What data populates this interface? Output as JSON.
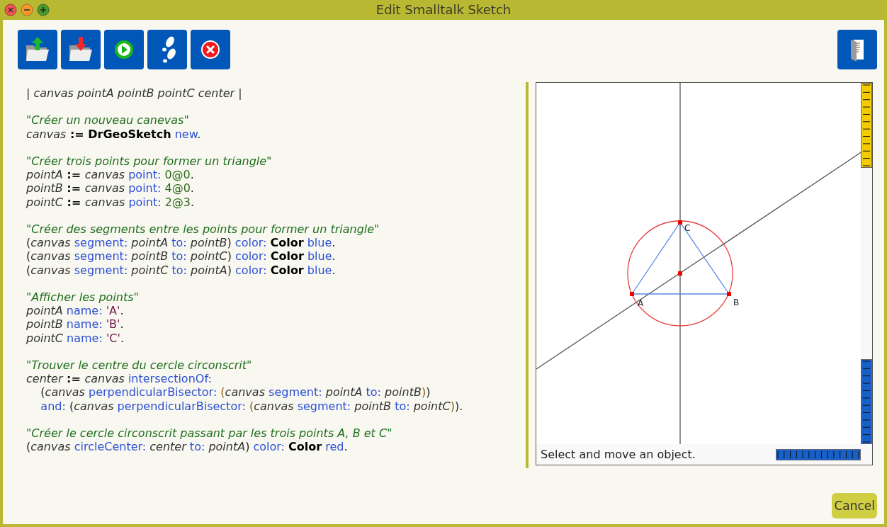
{
  "window": {
    "title": "Edit Smalltalk Sketch"
  },
  "code": [
    [
      [
        {
          "kind": "var",
          "text": "| canvas pointA pointB pointC center |"
        }
      ]
    ],
    [
      [
        {
          "kind": "comment",
          "text": "\"Créer un nouveau canevas\""
        }
      ],
      [
        {
          "kind": "var",
          "text": "canvas"
        },
        {
          "kind": "op",
          "text": " := "
        },
        {
          "kind": "cls",
          "text": "DrGeoSketch"
        },
        {
          "kind": "msg",
          "text": " new"
        },
        {
          "kind": "plain",
          "text": "."
        }
      ]
    ],
    [
      [
        {
          "kind": "comment",
          "text": "\"Créer trois points pour former un triangle\""
        }
      ],
      [
        {
          "kind": "var",
          "text": "pointA"
        },
        {
          "kind": "op",
          "text": " := "
        },
        {
          "kind": "var",
          "text": "canvas"
        },
        {
          "kind": "msg",
          "text": " point: "
        },
        {
          "kind": "num",
          "text": "0@0"
        },
        {
          "kind": "plain",
          "text": "."
        }
      ],
      [
        {
          "kind": "var",
          "text": "pointB"
        },
        {
          "kind": "op",
          "text": " := "
        },
        {
          "kind": "var",
          "text": "canvas"
        },
        {
          "kind": "msg",
          "text": " point: "
        },
        {
          "kind": "num",
          "text": "4@0"
        },
        {
          "kind": "plain",
          "text": "."
        }
      ],
      [
        {
          "kind": "var",
          "text": "pointC"
        },
        {
          "kind": "op",
          "text": " := "
        },
        {
          "kind": "var",
          "text": "canvas"
        },
        {
          "kind": "msg",
          "text": " point: "
        },
        {
          "kind": "num",
          "text": "2@3"
        },
        {
          "kind": "plain",
          "text": "."
        }
      ]
    ],
    [
      [
        {
          "kind": "comment",
          "text": "\"Créer des segments entre les points pour former un triangle\""
        }
      ],
      [
        {
          "kind": "plain",
          "text": "("
        },
        {
          "kind": "var",
          "text": "canvas"
        },
        {
          "kind": "msg",
          "text": " segment: "
        },
        {
          "kind": "var",
          "text": "pointA"
        },
        {
          "kind": "msg",
          "text": " to: "
        },
        {
          "kind": "var",
          "text": "pointB"
        },
        {
          "kind": "plain",
          "text": ")"
        },
        {
          "kind": "msg",
          "text": " color: "
        },
        {
          "kind": "cls",
          "text": "Color"
        },
        {
          "kind": "msg",
          "text": " blue"
        },
        {
          "kind": "plain",
          "text": "."
        }
      ],
      [
        {
          "kind": "plain",
          "text": "("
        },
        {
          "kind": "var",
          "text": "canvas"
        },
        {
          "kind": "msg",
          "text": " segment: "
        },
        {
          "kind": "var",
          "text": "pointB"
        },
        {
          "kind": "msg",
          "text": " to: "
        },
        {
          "kind": "var",
          "text": "pointC"
        },
        {
          "kind": "plain",
          "text": ")"
        },
        {
          "kind": "msg",
          "text": " color: "
        },
        {
          "kind": "cls",
          "text": "Color"
        },
        {
          "kind": "msg",
          "text": " blue"
        },
        {
          "kind": "plain",
          "text": "."
        }
      ],
      [
        {
          "kind": "plain",
          "text": "("
        },
        {
          "kind": "var",
          "text": "canvas"
        },
        {
          "kind": "msg",
          "text": " segment: "
        },
        {
          "kind": "var",
          "text": "pointC"
        },
        {
          "kind": "msg",
          "text": " to: "
        },
        {
          "kind": "var",
          "text": "pointA"
        },
        {
          "kind": "plain",
          "text": ")"
        },
        {
          "kind": "msg",
          "text": " color: "
        },
        {
          "kind": "cls",
          "text": "Color"
        },
        {
          "kind": "msg",
          "text": " blue"
        },
        {
          "kind": "plain",
          "text": "."
        }
      ]
    ],
    [
      [
        {
          "kind": "comment",
          "text": "\"Afficher les points\""
        }
      ],
      [
        {
          "kind": "var",
          "text": "pointA"
        },
        {
          "kind": "msg",
          "text": " name: "
        },
        {
          "kind": "str",
          "text": "'A'"
        },
        {
          "kind": "plain",
          "text": "."
        }
      ],
      [
        {
          "kind": "var",
          "text": "pointB"
        },
        {
          "kind": "msg",
          "text": " name: "
        },
        {
          "kind": "str",
          "text": "'B'"
        },
        {
          "kind": "plain",
          "text": "."
        }
      ],
      [
        {
          "kind": "var",
          "text": "pointC"
        },
        {
          "kind": "msg",
          "text": " name: "
        },
        {
          "kind": "str",
          "text": "'C'"
        },
        {
          "kind": "plain",
          "text": "."
        }
      ]
    ],
    [
      [
        {
          "kind": "comment",
          "text": "\"Trouver le centre du cercle circonscrit\""
        }
      ],
      [
        {
          "kind": "var",
          "text": "center"
        },
        {
          "kind": "op",
          "text": " := "
        },
        {
          "kind": "var",
          "text": "canvas"
        },
        {
          "kind": "msg",
          "text": " intersectionOf:"
        }
      ],
      [
        {
          "kind": "plain",
          "text": "    ("
        },
        {
          "kind": "var",
          "text": "canvas"
        },
        {
          "kind": "msg",
          "text": " perpendicularBisector: "
        },
        {
          "kind": "paren",
          "text": "("
        },
        {
          "kind": "var",
          "text": "canvas"
        },
        {
          "kind": "msg",
          "text": " segment: "
        },
        {
          "kind": "var",
          "text": "pointA"
        },
        {
          "kind": "msg",
          "text": " to: "
        },
        {
          "kind": "var",
          "text": "pointB"
        },
        {
          "kind": "paren",
          "text": ")"
        },
        {
          "kind": "plain",
          "text": ")"
        }
      ],
      [
        {
          "kind": "msg",
          "text": "    and: "
        },
        {
          "kind": "plain",
          "text": "("
        },
        {
          "kind": "var",
          "text": "canvas"
        },
        {
          "kind": "msg",
          "text": " perpendicularBisector: "
        },
        {
          "kind": "paren",
          "text": "("
        },
        {
          "kind": "var",
          "text": "canvas"
        },
        {
          "kind": "msg",
          "text": " segment: "
        },
        {
          "kind": "var",
          "text": "pointB"
        },
        {
          "kind": "msg",
          "text": " to: "
        },
        {
          "kind": "var",
          "text": "pointC"
        },
        {
          "kind": "paren",
          "text": ")"
        },
        {
          "kind": "plain",
          "text": ")."
        }
      ]
    ],
    [
      [
        {
          "kind": "comment",
          "text": "\"Créer le cercle circonscrit passant par les trois points A, B et C\""
        }
      ],
      [
        {
          "kind": "plain",
          "text": "("
        },
        {
          "kind": "var",
          "text": "canvas"
        },
        {
          "kind": "msg",
          "text": " circleCenter: "
        },
        {
          "kind": "var",
          "text": "center"
        },
        {
          "kind": "msg",
          "text": " to: "
        },
        {
          "kind": "var",
          "text": "pointA"
        },
        {
          "kind": "plain",
          "text": ")"
        },
        {
          "kind": "msg",
          "text": " color: "
        },
        {
          "kind": "cls",
          "text": "Color"
        },
        {
          "kind": "msg",
          "text": " red"
        },
        {
          "kind": "plain",
          "text": "."
        }
      ]
    ]
  ],
  "sketch": {
    "point_labels": [
      "A",
      "B",
      "C"
    ],
    "status": "Select and move an object."
  },
  "buttons": {
    "cancel": "Cancel"
  }
}
